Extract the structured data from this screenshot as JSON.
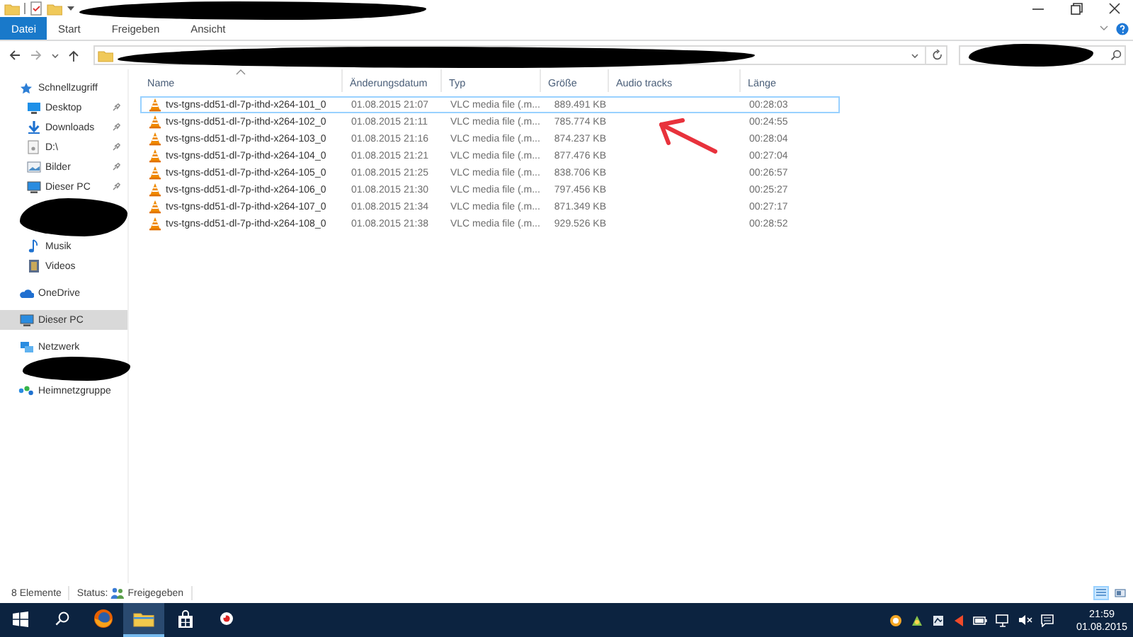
{
  "ribbon": {
    "tabs": [
      {
        "label": "Datei",
        "kind": "file"
      },
      {
        "label": "Start",
        "kind": "tab"
      },
      {
        "label": "Freigeben",
        "kind": "tab"
      },
      {
        "label": "Ansicht",
        "kind": "tab"
      }
    ]
  },
  "sidebar": {
    "items": [
      {
        "label": "Schnellzugriff",
        "kind": "star",
        "selected": false,
        "children": [
          {
            "label": "Desktop",
            "kind": "desktop",
            "pinned": true,
            "selected": false
          },
          {
            "label": "Downloads",
            "kind": "download",
            "pinned": true,
            "selected": false
          },
          {
            "label": "D:\\",
            "kind": "drive",
            "pinned": true,
            "selected": false
          },
          {
            "label": "Bilder",
            "kind": "pictures",
            "pinned": true,
            "selected": false
          },
          {
            "label": "Dieser PC",
            "kind": "computer",
            "pinned": true,
            "selected": false
          },
          {
            "label": "Musik",
            "kind": "music",
            "pinned": false,
            "selected": false
          },
          {
            "label": "Videos",
            "kind": "video",
            "pinned": false,
            "selected": false
          }
        ]
      },
      {
        "label": "OneDrive",
        "kind": "cloud",
        "selected": false
      },
      {
        "label": "Dieser PC",
        "kind": "computer",
        "selected": true
      },
      {
        "label": "Netzwerk",
        "kind": "network",
        "selected": false
      },
      {
        "label": "Heimnetzgruppe",
        "kind": "homegroup",
        "selected": false
      }
    ]
  },
  "table": {
    "columns": [
      {
        "label": "Name",
        "sorted": true
      },
      {
        "label": "Änderungsdatum",
        "sorted": false
      },
      {
        "label": "Typ",
        "sorted": false
      },
      {
        "label": "Größe",
        "sorted": false
      },
      {
        "label": "Audio tracks",
        "sorted": false
      },
      {
        "label": "Länge",
        "sorted": false
      }
    ],
    "rows": [
      {
        "name": "tvs-tgns-dd51-dl-7p-ithd-x264-101_0",
        "modified": "01.08.2015 21:07",
        "type": "VLC media file (.m...",
        "size": "889.491 KB",
        "length": "00:28:03",
        "selected": true
      },
      {
        "name": "tvs-tgns-dd51-dl-7p-ithd-x264-102_0",
        "modified": "01.08.2015 21:11",
        "type": "VLC media file (.m...",
        "size": "785.774 KB",
        "length": "00:24:55",
        "selected": false
      },
      {
        "name": "tvs-tgns-dd51-dl-7p-ithd-x264-103_0",
        "modified": "01.08.2015 21:16",
        "type": "VLC media file (.m...",
        "size": "874.237 KB",
        "length": "00:28:04",
        "selected": false
      },
      {
        "name": "tvs-tgns-dd51-dl-7p-ithd-x264-104_0",
        "modified": "01.08.2015 21:21",
        "type": "VLC media file (.m...",
        "size": "877.476 KB",
        "length": "00:27:04",
        "selected": false
      },
      {
        "name": "tvs-tgns-dd51-dl-7p-ithd-x264-105_0",
        "modified": "01.08.2015 21:25",
        "type": "VLC media file (.m...",
        "size": "838.706 KB",
        "length": "00:26:57",
        "selected": false
      },
      {
        "name": "tvs-tgns-dd51-dl-7p-ithd-x264-106_0",
        "modified": "01.08.2015 21:30",
        "type": "VLC media file (.m...",
        "size": "797.456 KB",
        "length": "00:25:27",
        "selected": false
      },
      {
        "name": "tvs-tgns-dd51-dl-7p-ithd-x264-107_0",
        "modified": "01.08.2015 21:34",
        "type": "VLC media file (.m...",
        "size": "871.349 KB",
        "length": "00:27:17",
        "selected": false
      },
      {
        "name": "tvs-tgns-dd51-dl-7p-ithd-x264-108_0",
        "modified": "01.08.2015 21:38",
        "type": "VLC media file (.m...",
        "size": "929.526 KB",
        "length": "00:28:52",
        "selected": false
      }
    ]
  },
  "status_bar": {
    "count": "8 Elemente",
    "status_label": "Status:",
    "status_value": "Freigegeben",
    "views": [
      {
        "kind": "details",
        "selected": true
      },
      {
        "kind": "tiles",
        "selected": false
      }
    ]
  },
  "taskbar": {
    "apps": [
      {
        "kind": "firefox",
        "active": false
      },
      {
        "kind": "explorer",
        "active": true
      },
      {
        "kind": "store",
        "active": false
      },
      {
        "kind": "app",
        "active": false
      }
    ],
    "time": "21:59",
    "date": "01.08.2015"
  }
}
